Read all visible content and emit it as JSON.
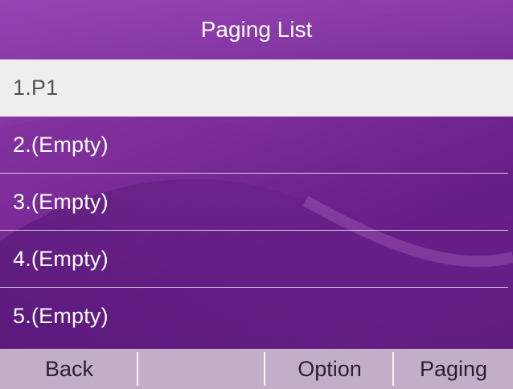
{
  "header": {
    "title": "Paging List"
  },
  "list": {
    "items": [
      {
        "label": "1.P1"
      },
      {
        "label": "2.(Empty)"
      },
      {
        "label": "3.(Empty)"
      },
      {
        "label": "4.(Empty)"
      },
      {
        "label": "5.(Empty)"
      }
    ],
    "selected_index": 0
  },
  "softkeys": {
    "back": "Back",
    "empty": "",
    "option": "Option",
    "paging": "Paging"
  },
  "colors": {
    "background": "#7d2d99",
    "selected_row": "#f1ecf1",
    "softkey_bar": "#c2aec8",
    "text_light": "#ffffff",
    "text_dark": "#555055"
  }
}
